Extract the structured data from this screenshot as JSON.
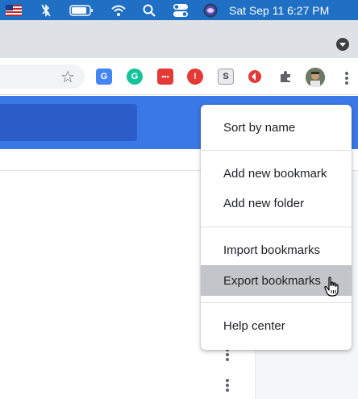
{
  "menubar": {
    "clock": "Sat Sep 11  6:27 PM",
    "icons": [
      "us-flag-icon",
      "bluetooth-off-icon",
      "battery-icon",
      "wifi-icon",
      "spotlight-search-icon",
      "control-center-icon",
      "siri-icon"
    ]
  },
  "toolbar": {
    "bookmark_star": "☆",
    "extensions": [
      {
        "name": "google-translate-extension-icon",
        "label": "G",
        "color": "#4285f4"
      },
      {
        "name": "grammarly-extension-icon",
        "label": "G",
        "color": "#15c39a"
      },
      {
        "name": "red-dots-extension-icon",
        "label": "•••",
        "color": "#e53935"
      },
      {
        "name": "adblock-extension-icon",
        "label": "!",
        "color": "#e53935"
      },
      {
        "name": "s-extension-icon",
        "label": "S",
        "color": "#9e9e9e"
      },
      {
        "name": "red-arrow-extension-icon",
        "label": "",
        "color": "#e53935"
      }
    ]
  },
  "menu": {
    "items": [
      {
        "label": "Sort by name"
      },
      {
        "label": "Add new bookmark"
      },
      {
        "label": "Add new folder"
      },
      {
        "label": "Import bookmarks"
      },
      {
        "label": "Export bookmarks",
        "highlighted": true
      },
      {
        "label": "Help center"
      }
    ]
  },
  "colors": {
    "menubar": "#1f6fc4",
    "page_header": "#3b78e7",
    "highlight": "#c2c5c9"
  }
}
